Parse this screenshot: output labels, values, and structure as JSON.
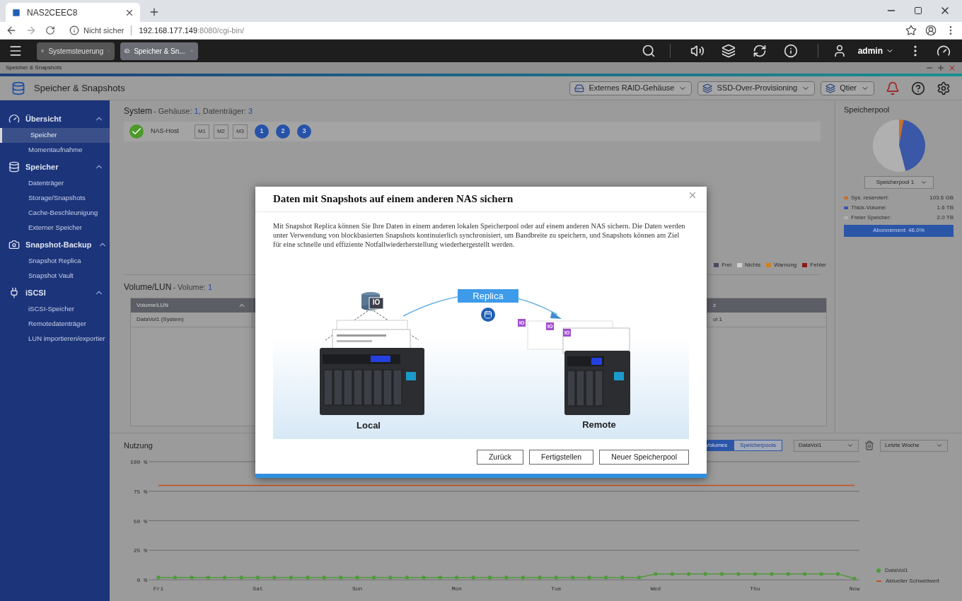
{
  "browser": {
    "tab": {
      "title": "NAS2CEEC8"
    },
    "security": "Nicht sicher",
    "url_host": "192.168.177.149",
    "url_rest": ":8080/cgi-bin/"
  },
  "taskbar": {
    "tabs": [
      {
        "label": "Systemsteuerung",
        "selected": false
      },
      {
        "label": "Speicher & Sn...",
        "selected": true
      }
    ],
    "user": "admin"
  },
  "window": {
    "title": "Speicher & Snapshots"
  },
  "app": {
    "title": "Speicher & Snapshots",
    "toolbar": [
      {
        "label": "Externes RAID-Gehäuse"
      },
      {
        "label": "SSD-Over-Provisioning"
      },
      {
        "label": "Qtier"
      }
    ]
  },
  "sidebar": {
    "groups": [
      {
        "label": "Übersicht",
        "expanded": true,
        "items": [
          {
            "label": "Speicher",
            "selected": true
          },
          {
            "label": "Momentaufnahme",
            "selected": false
          }
        ]
      },
      {
        "label": "Speicher",
        "expanded": true,
        "items": [
          {
            "label": "Datenträger",
            "selected": false
          },
          {
            "label": "Storage/Snapshots",
            "selected": false
          },
          {
            "label": "Cache-Beschleunigung",
            "selected": false
          },
          {
            "label": "Externer Speicher",
            "selected": false
          }
        ]
      },
      {
        "label": "Snapshot-Backup",
        "expanded": true,
        "items": [
          {
            "label": "Snapshot Replica",
            "selected": false
          },
          {
            "label": "Snapshot Vault",
            "selected": false
          }
        ]
      },
      {
        "label": "iSCSI",
        "expanded": true,
        "items": [
          {
            "label": "iSCSI-Speicher",
            "selected": false
          },
          {
            "label": "Remotedatenträger",
            "selected": false
          },
          {
            "label": "LUN importieren/exportier",
            "selected": false
          }
        ]
      }
    ]
  },
  "system": {
    "title": "System",
    "subtitle": [
      {
        "text": " - Gehäuse: ",
        "kind": "label"
      },
      {
        "text": "1",
        "kind": "value"
      },
      {
        "text": ", Datenträger: ",
        "kind": "label"
      },
      {
        "text": "3",
        "kind": "value"
      }
    ],
    "host": "NAS-Host",
    "slots": [
      {
        "label": "M1",
        "kind": "slot"
      },
      {
        "label": "M2",
        "kind": "slot"
      },
      {
        "label": "M3",
        "kind": "slot"
      },
      {
        "label": "1",
        "kind": "disk"
      },
      {
        "label": "2",
        "kind": "disk"
      },
      {
        "label": "3",
        "kind": "disk"
      }
    ],
    "legend": [
      {
        "label": "Frei",
        "color": "#4b4b63"
      },
      {
        "label": "Nichts",
        "color": "#d0d0d0"
      },
      {
        "label": "Warnung",
        "color": "#d2801e"
      },
      {
        "label": "Fehler",
        "color": "#8b1a1a"
      }
    ]
  },
  "volumes": {
    "title": "Volume/LUN",
    "subtitle": [
      {
        "text": " - Volume: ",
        "kind": "label"
      },
      {
        "text": "1",
        "kind": "value"
      }
    ],
    "columns": [
      {
        "label": "Volume/LUN",
        "sorted": true
      },
      {
        "label": "z"
      }
    ],
    "rows": [
      {
        "cells": [
          "DataVol1 (System)",
          "ol 1"
        ]
      }
    ]
  },
  "pool_panel": {
    "title": "Speicherpool",
    "chart_data": {
      "type": "pie",
      "values": [
        2.8,
        43.2,
        54.0
      ]
    },
    "select": "Speicherpool 1",
    "legend": [
      {
        "label": "Sys. reserviert:",
        "value": "103.6 GB",
        "color": "#c8702a"
      },
      {
        "label": "Thick-Volume:",
        "value": "1.6 TB",
        "color": "#3b57a8"
      },
      {
        "label": "Freier Speicher:",
        "value": "2.0 TB",
        "color": "#b0b0b0"
      }
    ],
    "subscription": "Abonnement: 46.0%"
  },
  "usage": {
    "title": "Nutzung",
    "views": [
      {
        "label": "Volumes",
        "selected": true
      },
      {
        "label": "Speicherpools",
        "selected": false
      }
    ],
    "volume_select": "DataVol1",
    "period_select": "Letzte Woche",
    "chart_data": {
      "type": "line",
      "categories": [
        "Fri",
        null,
        null,
        null,
        null,
        null,
        "Sat",
        null,
        null,
        null,
        null,
        null,
        "Sun",
        null,
        null,
        null,
        null,
        null,
        "Mon",
        null,
        null,
        null,
        null,
        null,
        "Tue",
        null,
        null,
        null,
        null,
        null,
        "Wed",
        null,
        null,
        null,
        null,
        null,
        "Thu",
        null,
        null,
        null,
        null,
        null,
        "Now"
      ],
      "yticks": [
        {
          "value": 0,
          "label": "0 %"
        },
        {
          "value": 25,
          "label": "25 %"
        },
        {
          "value": 50,
          "label": "50 %"
        },
        {
          "value": 75,
          "label": "75 %"
        },
        {
          "value": 100,
          "label": "100 %"
        }
      ],
      "ylim": [
        0,
        100
      ],
      "grid": true,
      "series": [
        {
          "name": "DataVol1",
          "color": "#4f9a3a",
          "values": [
            2,
            2,
            2,
            2,
            2,
            2,
            2,
            2,
            2,
            2,
            2,
            2,
            2,
            2,
            2,
            2,
            2,
            2,
            2,
            2,
            2,
            2,
            2,
            2,
            2,
            2,
            2,
            2,
            2,
            2,
            5,
            5,
            5,
            5,
            5,
            5,
            5,
            5,
            5,
            5,
            5,
            5,
            1
          ]
        },
        {
          "name": "Aktueller Schwellwert",
          "color": "#c4501e",
          "values": [
            80,
            80,
            80,
            80,
            80,
            80,
            80,
            80,
            80,
            80,
            80,
            80,
            80,
            80,
            80,
            80,
            80,
            80,
            80,
            80,
            80,
            80,
            80,
            80,
            80,
            80,
            80,
            80,
            80,
            80,
            80,
            80,
            80,
            80,
            80,
            80,
            80,
            80,
            80,
            80,
            80,
            80,
            80
          ]
        }
      ]
    }
  },
  "dialog": {
    "title": "Daten mit Snapshots auf einem anderen NAS sichern",
    "text": "Mit Snapshot Replica können Sie Ihre Daten in einem anderen lokalen Speicherpool oder auf einem anderen NAS sichern. Die Daten werden unter Verwendung von blockbasierten Snapshots kontinuierlich synchronisiert, um Bandbreite zu speichern, und Snapshots können am Ziel für eine schnelle und effiziente Notfallwiederherstellung wiederhergestellt werden.",
    "illustration": {
      "replica": "Replica",
      "local": "Local",
      "remote": "Remote",
      "local_badge": "IO",
      "remote_badges": [
        "IO",
        "IO",
        "IO"
      ]
    },
    "buttons": [
      "Zurück",
      "Fertigstellen",
      "Neuer Speicherpool"
    ]
  }
}
